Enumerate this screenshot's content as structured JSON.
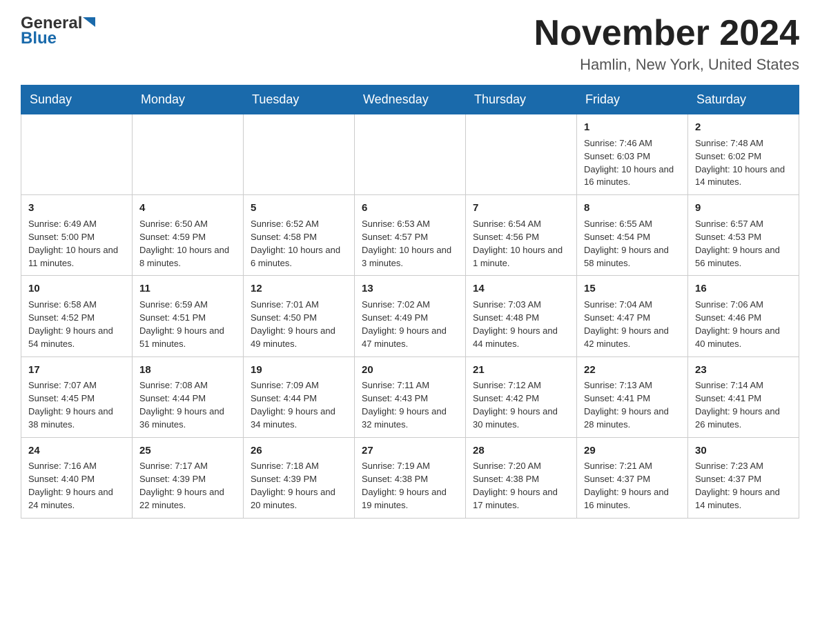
{
  "logo": {
    "general": "General",
    "blue": "Blue"
  },
  "header": {
    "title": "November 2024",
    "subtitle": "Hamlin, New York, United States"
  },
  "days": {
    "headers": [
      "Sunday",
      "Monday",
      "Tuesday",
      "Wednesday",
      "Thursday",
      "Friday",
      "Saturday"
    ]
  },
  "weeks": [
    {
      "cells": [
        {
          "day": "",
          "info": ""
        },
        {
          "day": "",
          "info": ""
        },
        {
          "day": "",
          "info": ""
        },
        {
          "day": "",
          "info": ""
        },
        {
          "day": "",
          "info": ""
        },
        {
          "day": "1",
          "info": "Sunrise: 7:46 AM\nSunset: 6:03 PM\nDaylight: 10 hours and 16 minutes."
        },
        {
          "day": "2",
          "info": "Sunrise: 7:48 AM\nSunset: 6:02 PM\nDaylight: 10 hours and 14 minutes."
        }
      ]
    },
    {
      "cells": [
        {
          "day": "3",
          "info": "Sunrise: 6:49 AM\nSunset: 5:00 PM\nDaylight: 10 hours and 11 minutes."
        },
        {
          "day": "4",
          "info": "Sunrise: 6:50 AM\nSunset: 4:59 PM\nDaylight: 10 hours and 8 minutes."
        },
        {
          "day": "5",
          "info": "Sunrise: 6:52 AM\nSunset: 4:58 PM\nDaylight: 10 hours and 6 minutes."
        },
        {
          "day": "6",
          "info": "Sunrise: 6:53 AM\nSunset: 4:57 PM\nDaylight: 10 hours and 3 minutes."
        },
        {
          "day": "7",
          "info": "Sunrise: 6:54 AM\nSunset: 4:56 PM\nDaylight: 10 hours and 1 minute."
        },
        {
          "day": "8",
          "info": "Sunrise: 6:55 AM\nSunset: 4:54 PM\nDaylight: 9 hours and 58 minutes."
        },
        {
          "day": "9",
          "info": "Sunrise: 6:57 AM\nSunset: 4:53 PM\nDaylight: 9 hours and 56 minutes."
        }
      ]
    },
    {
      "cells": [
        {
          "day": "10",
          "info": "Sunrise: 6:58 AM\nSunset: 4:52 PM\nDaylight: 9 hours and 54 minutes."
        },
        {
          "day": "11",
          "info": "Sunrise: 6:59 AM\nSunset: 4:51 PM\nDaylight: 9 hours and 51 minutes."
        },
        {
          "day": "12",
          "info": "Sunrise: 7:01 AM\nSunset: 4:50 PM\nDaylight: 9 hours and 49 minutes."
        },
        {
          "day": "13",
          "info": "Sunrise: 7:02 AM\nSunset: 4:49 PM\nDaylight: 9 hours and 47 minutes."
        },
        {
          "day": "14",
          "info": "Sunrise: 7:03 AM\nSunset: 4:48 PM\nDaylight: 9 hours and 44 minutes."
        },
        {
          "day": "15",
          "info": "Sunrise: 7:04 AM\nSunset: 4:47 PM\nDaylight: 9 hours and 42 minutes."
        },
        {
          "day": "16",
          "info": "Sunrise: 7:06 AM\nSunset: 4:46 PM\nDaylight: 9 hours and 40 minutes."
        }
      ]
    },
    {
      "cells": [
        {
          "day": "17",
          "info": "Sunrise: 7:07 AM\nSunset: 4:45 PM\nDaylight: 9 hours and 38 minutes."
        },
        {
          "day": "18",
          "info": "Sunrise: 7:08 AM\nSunset: 4:44 PM\nDaylight: 9 hours and 36 minutes."
        },
        {
          "day": "19",
          "info": "Sunrise: 7:09 AM\nSunset: 4:44 PM\nDaylight: 9 hours and 34 minutes."
        },
        {
          "day": "20",
          "info": "Sunrise: 7:11 AM\nSunset: 4:43 PM\nDaylight: 9 hours and 32 minutes."
        },
        {
          "day": "21",
          "info": "Sunrise: 7:12 AM\nSunset: 4:42 PM\nDaylight: 9 hours and 30 minutes."
        },
        {
          "day": "22",
          "info": "Sunrise: 7:13 AM\nSunset: 4:41 PM\nDaylight: 9 hours and 28 minutes."
        },
        {
          "day": "23",
          "info": "Sunrise: 7:14 AM\nSunset: 4:41 PM\nDaylight: 9 hours and 26 minutes."
        }
      ]
    },
    {
      "cells": [
        {
          "day": "24",
          "info": "Sunrise: 7:16 AM\nSunset: 4:40 PM\nDaylight: 9 hours and 24 minutes."
        },
        {
          "day": "25",
          "info": "Sunrise: 7:17 AM\nSunset: 4:39 PM\nDaylight: 9 hours and 22 minutes."
        },
        {
          "day": "26",
          "info": "Sunrise: 7:18 AM\nSunset: 4:39 PM\nDaylight: 9 hours and 20 minutes."
        },
        {
          "day": "27",
          "info": "Sunrise: 7:19 AM\nSunset: 4:38 PM\nDaylight: 9 hours and 19 minutes."
        },
        {
          "day": "28",
          "info": "Sunrise: 7:20 AM\nSunset: 4:38 PM\nDaylight: 9 hours and 17 minutes."
        },
        {
          "day": "29",
          "info": "Sunrise: 7:21 AM\nSunset: 4:37 PM\nDaylight: 9 hours and 16 minutes."
        },
        {
          "day": "30",
          "info": "Sunrise: 7:23 AM\nSunset: 4:37 PM\nDaylight: 9 hours and 14 minutes."
        }
      ]
    }
  ]
}
